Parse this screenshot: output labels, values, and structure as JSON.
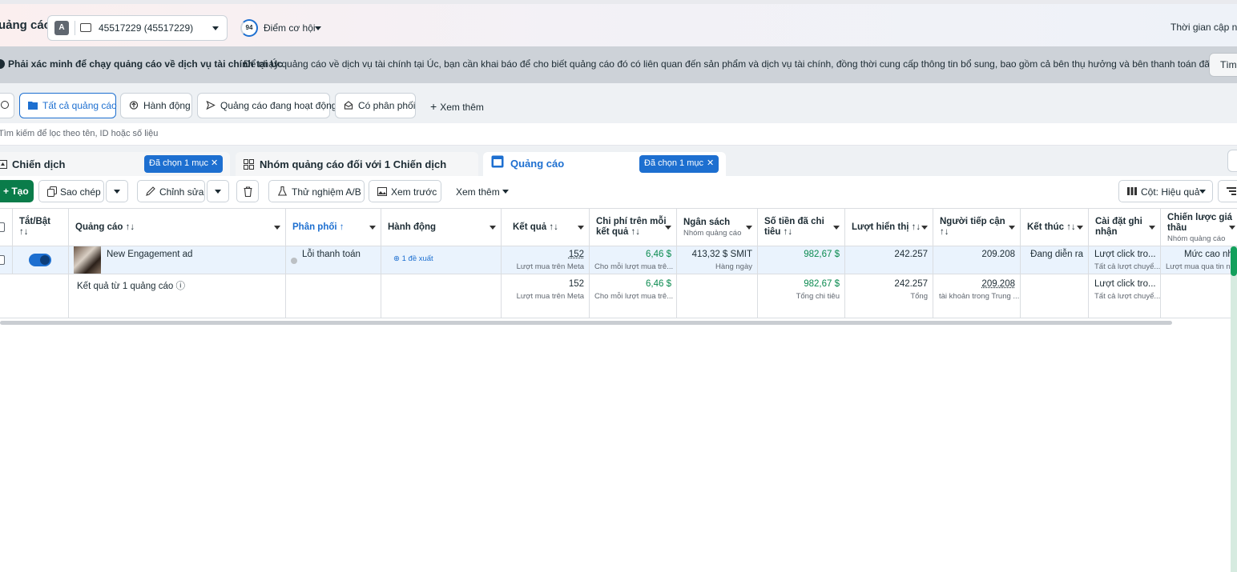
{
  "header": {
    "app_title": "uảng cáo",
    "account_badge": "A",
    "account_name": "45517229 (45517229)",
    "opportunity_score": "94",
    "opportunity_label": "Điểm cơ hội",
    "update_time_label": "Thời gian cập nhậ"
  },
  "notice": {
    "title": "Phải xác minh để chạy quảng cáo về dịch vụ tài chính tại Úc",
    "body": "Để chạy quảng cáo về dịch vụ tài chính tại Úc, bạn cần khai báo để cho biết quảng cáo đó có liên quan đến sản phẩm và dịch vụ tài chính, đồng thời cung cấp thông tin bổ sung, bao gồm cả bên thụ hưởng và bên thanh toán đã xác minh.",
    "button": "Tìm"
  },
  "filters": {
    "items": [
      "Tất cả quảng cáo",
      "Hành động",
      "Quảng cáo đang hoạt động",
      "Có phân phối"
    ],
    "more": "Xem thêm",
    "search_placeholder": "Tìm kiếm để lọc theo tên, ID hoặc số liệu"
  },
  "tabs": {
    "campaign": "Chiến dịch",
    "campaign_chip": "Đã chọn 1 mục",
    "adset": "Nhóm quảng cáo đối với 1 Chiến dịch",
    "ads": "Quảng cáo",
    "ads_chip": "Đã chọn 1 mục"
  },
  "toolbar": {
    "create": "Tạo",
    "duplicate": "Sao chép",
    "edit": "Chỉnh sửa",
    "ab_test": "Thử nghiệm A/B",
    "preview": "Xem trước",
    "more": "Xem thêm",
    "columns": "Cột: Hiệu quả"
  },
  "table": {
    "headers": {
      "toggle": "Tắt/Bật ↑↓",
      "ad": "Quảng cáo ↑↓",
      "delivery": "Phân phối ↑",
      "actions": "Hành động",
      "results": "Kết quả ↑↓",
      "cost_per_result_1": "Chi phí trên mỗi",
      "cost_per_result_2": "kết quả ↑↓",
      "budget": "Ngân sách",
      "budget_sub": "Nhóm quảng cáo",
      "amount_spent_1": "Số tiền đã chi",
      "amount_spent_2": "tiêu ↑↓",
      "impressions": "Lượt hiển thị ↑↓",
      "reach_1": "Người tiếp cận",
      "reach_2": "↑↓",
      "ends": "Kết thúc ↑↓",
      "attribution_1": "Cài đặt ghi",
      "attribution_2": "nhận",
      "bid_1": "Chiến lược giá",
      "bid_2": "thầu",
      "bid_sub": "Nhóm quảng cáo"
    },
    "row": {
      "ad_name": "New Engagement ad",
      "delivery": "Lỗi thanh toán",
      "actions": "1 đề xuất",
      "results": "152",
      "results_sub": "Lượt mua trên Meta",
      "cost_per_result": "6,46 $",
      "cost_sub": "Cho mỗi lượt mua trê...",
      "budget": "413,32 $ SMIT",
      "budget_sub": "Hàng ngày",
      "amount_spent": "982,67 $",
      "impressions": "242.257",
      "reach": "209.208",
      "ends": "Đang diễn ra",
      "attribution": "Lượt click tro...",
      "attribution_sub": "Tất cả lượt chuyể...",
      "bid": "Mức cao nhấ",
      "bid_sub": "Lượt mua qua tin n..."
    },
    "summary": {
      "label": "Kết quả từ 1 quảng cáo",
      "results": "152",
      "results_sub": "Lượt mua trên Meta",
      "cost_per_result": "6,46 $",
      "cost_sub": "Cho mỗi lượt mua trê...",
      "amount_spent": "982,67 $",
      "amount_sub": "Tổng chi tiêu",
      "impressions": "242.257",
      "impressions_sub": "Tổng",
      "reach": "209.208",
      "reach_sub": "tài khoản trong Trung ...",
      "attribution": "Lượt click tro...",
      "attribution_sub": "Tất cả lượt chuyể..."
    }
  }
}
